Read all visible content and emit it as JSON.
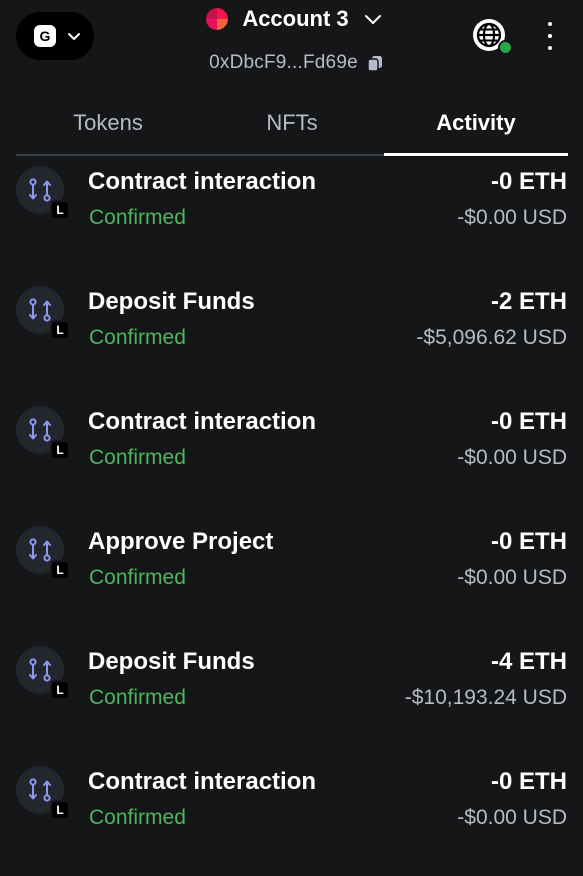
{
  "network": {
    "badge": "G"
  },
  "account": {
    "name": "Account 3",
    "address": "0xDbcF9...Fd69e"
  },
  "tabs": [
    {
      "label": "Tokens",
      "active": false
    },
    {
      "label": "NFTs",
      "active": false
    },
    {
      "label": "Activity",
      "active": true
    }
  ],
  "transactions": [
    {
      "title": "Contract interaction",
      "status": "Confirmed",
      "amount": "-0 ETH",
      "fiat": "-$0.00 USD",
      "badge": "L"
    },
    {
      "title": "Deposit Funds",
      "status": "Confirmed",
      "amount": "-2 ETH",
      "fiat": "-$5,096.62 USD",
      "badge": "L"
    },
    {
      "title": "Contract interaction",
      "status": "Confirmed",
      "amount": "-0 ETH",
      "fiat": "-$0.00 USD",
      "badge": "L"
    },
    {
      "title": "Approve Project",
      "status": "Confirmed",
      "amount": "-0 ETH",
      "fiat": "-$0.00 USD",
      "badge": "L"
    },
    {
      "title": "Deposit Funds",
      "status": "Confirmed",
      "amount": "-4 ETH",
      "fiat": "-$10,193.24 USD",
      "badge": "L"
    },
    {
      "title": "Contract interaction",
      "status": "Confirmed",
      "amount": "-0 ETH",
      "fiat": "-$0.00 USD",
      "badge": "L"
    }
  ],
  "colors": {
    "background": "#141618",
    "status_confirmed": "#4fb45e",
    "tab_active": "#ffffff",
    "connected_dot": "#28a745"
  },
  "icons": {
    "network_chevron": "chevron-down-icon",
    "account_chevron": "chevron-down-icon",
    "copy": "copy-icon",
    "globe": "globe-icon",
    "menu": "kebab-menu-icon",
    "transaction": "swap-arrows-icon"
  }
}
